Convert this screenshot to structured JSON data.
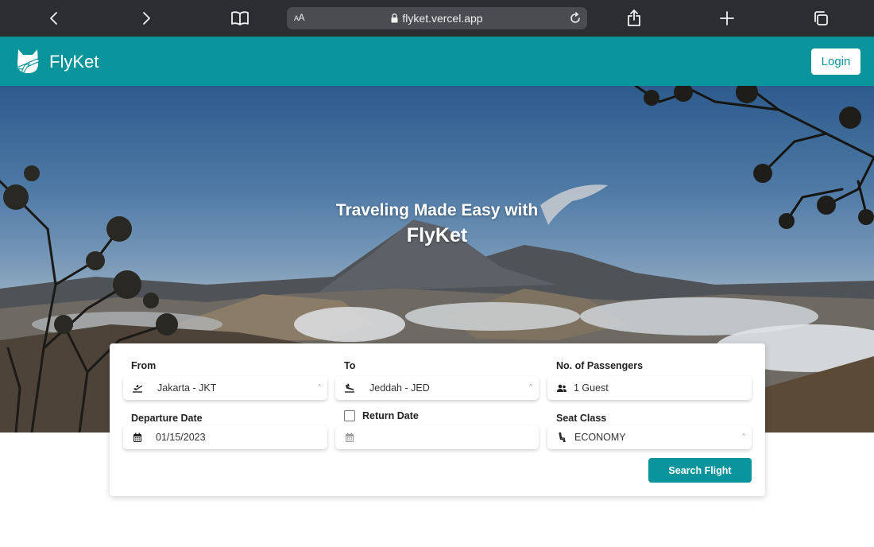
{
  "browser": {
    "url": "flyket.vercel.app",
    "text_size_label": "AA"
  },
  "header": {
    "brand": "FlyKet",
    "login_label": "Login"
  },
  "hero": {
    "line1": "Traveling Made Easy with",
    "line2": "FlyKet"
  },
  "search": {
    "from_label": "From",
    "from_value": "Jakarta - JKT",
    "to_label": "To",
    "to_value": "Jeddah - JED",
    "passengers_label": "No. of Passengers",
    "passengers_value": "1 Guest",
    "departure_label": "Departure Date",
    "departure_value": "01/15/2023",
    "return_label": "Return Date",
    "return_checked": false,
    "return_value": "",
    "seat_class_label": "Seat Class",
    "seat_class_value": "ECONOMY",
    "search_button": "Search Flight"
  },
  "colors": {
    "brand": "#0a949b",
    "browser_bar": "#2b2d31"
  },
  "icons": [
    "back-icon",
    "forward-icon",
    "book-icon",
    "lock-icon",
    "reload-icon",
    "share-icon",
    "plus-icon",
    "tabs-icon",
    "logo-icon",
    "plane-takeoff-icon",
    "plane-landing-icon",
    "people-icon",
    "calendar-icon",
    "seat-icon",
    "chevron-icon"
  ]
}
